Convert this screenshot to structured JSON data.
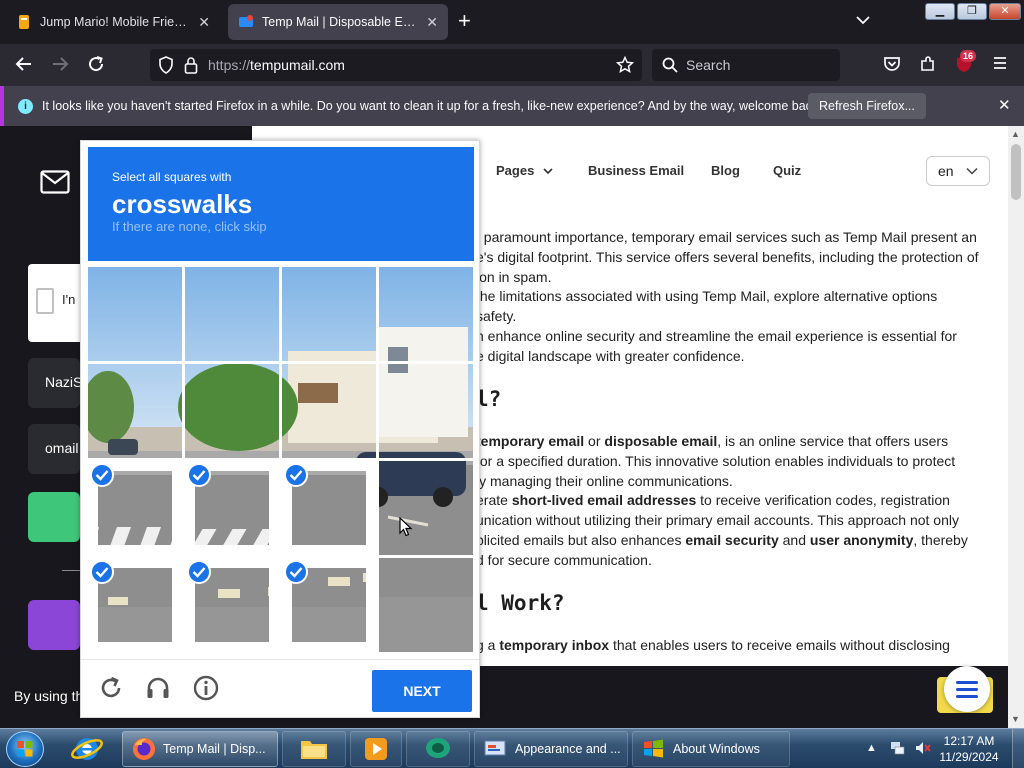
{
  "tabs": [
    {
      "title": "Jump Mario! Mobile Friendly G",
      "active": false
    },
    {
      "title": "Temp Mail | Disposable Email A",
      "active": true
    }
  ],
  "nav": {
    "url_protocol": "https://",
    "url_host": "tempumail.com",
    "search_placeholder": "Search",
    "extensions_badge": "16"
  },
  "notification": {
    "message": "It looks like you haven't started Firefox in a while. Do you want to clean it up for a fresh, like-new experience? And by the way, welcome back!",
    "button_label": "Refresh Firefox..."
  },
  "left_panel": {
    "input_1_value": "NaziS",
    "input_2_value": "omail",
    "checkbox_label": "I'n"
  },
  "site_nav": {
    "items": [
      "Pages",
      "Business Email",
      "Blog",
      "Quiz"
    ],
    "language": "en"
  },
  "content": {
    "lines_1": [
      "f paramount importance, temporary email services such as Temp Mail present an",
      "e's digital footprint. This service offers several benefits, including the protection of",
      "ion in spam.",
      "the limitations associated with using Temp Mail, explore alternative options",
      "safety.",
      "n enhance online security and streamline the email experience is essential for",
      "e digital landscape with greater confidence."
    ],
    "heading_1": "l?",
    "para_2": [
      [
        {
          "t": "temporary email",
          "b": true
        },
        {
          "t": " or ",
          "b": false
        },
        {
          "t": "disposable email",
          "b": true
        },
        {
          "t": ", is an online service that offers users",
          "b": false
        }
      ],
      [
        {
          "t": "for a specified duration. This innovative solution enables individuals to protect",
          "b": false
        }
      ],
      [
        {
          "t": "ly managing their online communications.",
          "b": false
        }
      ],
      [
        {
          "t": "erate ",
          "b": false
        },
        {
          "t": "short-lived email addresses",
          "b": true
        },
        {
          "t": " to receive verification codes, registration",
          "b": false
        }
      ],
      [
        {
          "t": "unication without utilizing their primary email accounts. This approach not only",
          "b": false
        }
      ],
      [
        {
          "t": "plicited emails but also enhances ",
          "b": false
        },
        {
          "t": "email security",
          "b": true
        },
        {
          "t": " and ",
          "b": false
        },
        {
          "t": "user anonymity",
          "b": true
        },
        {
          "t": ", thereby",
          "b": false
        }
      ],
      [
        {
          "t": "d for secure communication.",
          "b": false
        }
      ]
    ],
    "heading_2": "l Work?",
    "para_3": [
      [
        {
          "t": "g a ",
          "b": false
        },
        {
          "t": "temporary inbox",
          "b": true
        },
        {
          "t": " that enables users to receive emails without disclosing",
          "b": false
        }
      ]
    ]
  },
  "cookie_text": "By using th",
  "captcha": {
    "instruction": "Select all squares with",
    "target": "crosswalks",
    "hint": "If there are none, click skip",
    "selected_tiles": [
      8,
      9,
      10,
      12,
      13,
      14
    ],
    "next_label": "NEXT",
    "footer_icons": [
      "reload-icon",
      "audio-icon",
      "info-icon"
    ]
  },
  "taskbar": {
    "items": [
      {
        "label": "Temp Mail | Disp...",
        "icon": "firefox-icon",
        "active": true
      },
      {
        "label": "Appearance and ...",
        "icon": "control-panel-icon",
        "active": false
      },
      {
        "label": "About Windows",
        "icon": "windows-icon",
        "active": false
      }
    ],
    "pinned": [
      "ie-icon",
      "firefox-icon",
      "explorer-icon",
      "media-player-icon",
      "chat-icon"
    ],
    "time": "12:17 AM",
    "date": "11/29/2024"
  },
  "colors": {
    "captcha_blue": "#1a73e8",
    "firefox_tabbar": "#1c1b22",
    "firefox_toolbar": "#2b2a33",
    "notification_bar": "#42414d"
  }
}
